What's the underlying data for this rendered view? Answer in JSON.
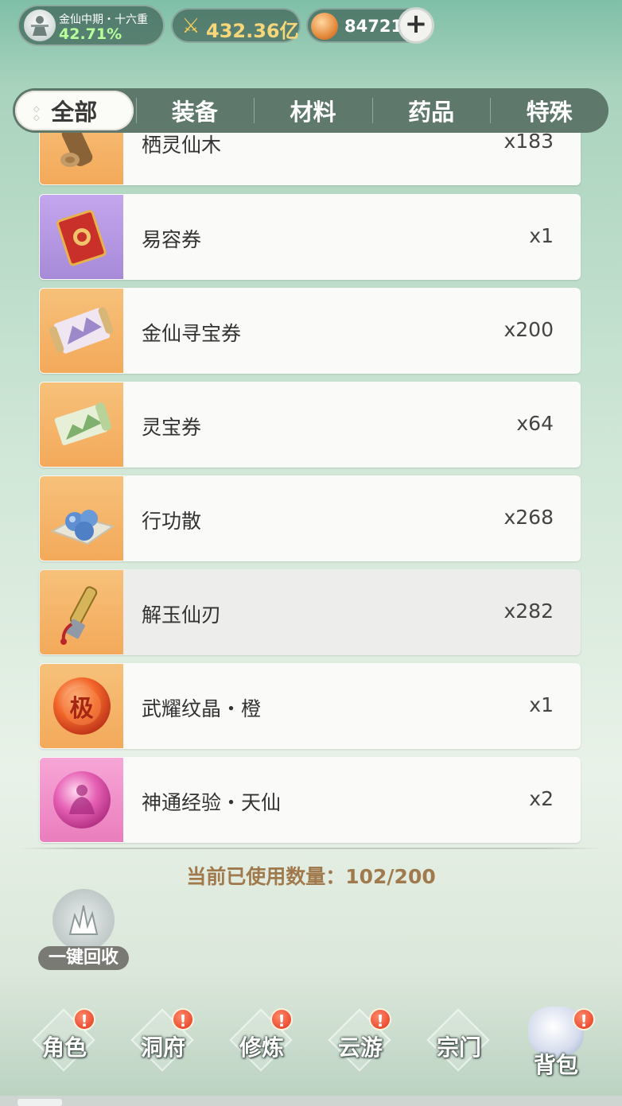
{
  "status_bar": {
    "realm": "金仙中期・十六重",
    "progress": "42.71%",
    "power": "432.36亿",
    "currency": "84721",
    "add_label": "+"
  },
  "tabs": [
    {
      "label": "全部",
      "active": true
    },
    {
      "label": "装备",
      "active": false
    },
    {
      "label": "材料",
      "active": false
    },
    {
      "label": "药品",
      "active": false
    },
    {
      "label": "特殊",
      "active": false
    }
  ],
  "items": [
    {
      "name": "栖灵仙木",
      "qty": "x183",
      "icon": "wood-log-icon",
      "rarity": "orange"
    },
    {
      "name": "易容券",
      "qty": "x1",
      "icon": "red-ticket-icon",
      "rarity": "purple"
    },
    {
      "name": "金仙寻宝券",
      "qty": "x200",
      "icon": "treasure-scroll-icon",
      "rarity": "orange"
    },
    {
      "name": "灵宝券",
      "qty": "x64",
      "icon": "green-scroll-icon",
      "rarity": "orange"
    },
    {
      "name": "行功散",
      "qty": "x268",
      "icon": "pills-icon",
      "rarity": "orange"
    },
    {
      "name": "解玉仙刃",
      "qty": "x282",
      "icon": "jade-blade-icon",
      "rarity": "orange"
    },
    {
      "name": "武耀纹晶・橙",
      "qty": "x1",
      "icon": "orange-orb-icon",
      "rarity": "orange",
      "orb_text": "极"
    },
    {
      "name": "神通经验・天仙",
      "qty": "x2",
      "icon": "pink-orb-icon",
      "rarity": "pink"
    }
  ],
  "capacity": "当前已使用数量：102/200",
  "recycle_label": "一键回收",
  "nav": [
    {
      "label": "角色",
      "alert": "!"
    },
    {
      "label": "洞府",
      "alert": "!"
    },
    {
      "label": "修炼",
      "alert": "!"
    },
    {
      "label": "云游",
      "alert": "!"
    },
    {
      "label": "宗门",
      "alert": ""
    },
    {
      "label": "背包",
      "alert": "!"
    }
  ],
  "colors": {
    "accent_text": "#a07a4c",
    "progress_green": "#b6ff9a",
    "power_gold": "#f7d77a",
    "alert_red": "#e2351c"
  }
}
